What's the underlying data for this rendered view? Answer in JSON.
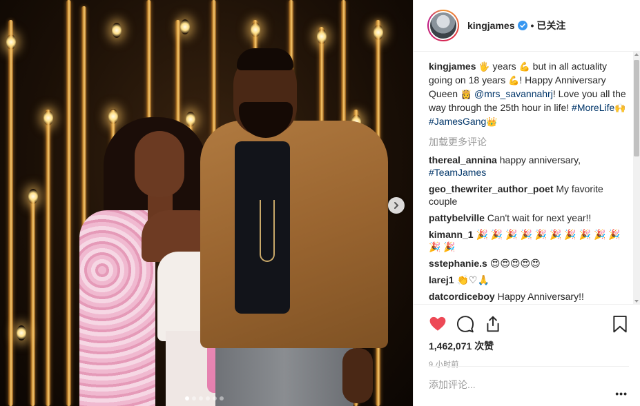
{
  "header": {
    "username": "kingjames",
    "follow_dot": "•",
    "follow_label": "已关注"
  },
  "caption": {
    "username": "kingjames",
    "segments": [
      {
        "t": " "
      },
      {
        "t": "🖐",
        "emoji": true
      },
      {
        "t": " years "
      },
      {
        "t": "💪",
        "emoji": true
      },
      {
        "t": " but in all actuality going on 18 years "
      },
      {
        "t": "💪",
        "emoji": true
      },
      {
        "t": "! Happy Anniversary Queen "
      },
      {
        "t": "👸",
        "emoji": true
      },
      {
        "t": " "
      },
      {
        "t": "@mrs_savannahrj",
        "tag": true
      },
      {
        "t": "! Love you all the way through the 25th hour in life! "
      },
      {
        "t": "#MoreLife",
        "tag": true
      },
      {
        "t": "🙌",
        "emoji": true
      },
      {
        "t": " "
      },
      {
        "t": "#JamesGang",
        "tag": true
      },
      {
        "t": "👑",
        "emoji": true
      }
    ]
  },
  "load_more": "加载更多评论",
  "comments": [
    {
      "user": "thereal_annina",
      "text": " happy anniversary, ",
      "tag": "#TeamJames"
    },
    {
      "user": "geo_thewriter_author_poet",
      "text": " My favorite couple",
      "tag": ""
    },
    {
      "user": "pattybelville",
      "text": " Can't wait for next year!!",
      "tag": ""
    },
    {
      "user": "kimann_1",
      "text": " 🎉 🎉 🎉 🎉 🎉 🎉 🎉 🎉 🎉 🎉 🎉 🎉",
      "tag": ""
    },
    {
      "user": "sstephanie.s",
      "text": " 😍😍😍😍😍",
      "tag": ""
    },
    {
      "user": "larej1",
      "text": " 👏♡🙏",
      "tag": ""
    },
    {
      "user": "datcordiceboy",
      "text": " Happy Anniversary!!",
      "tag": ""
    }
  ],
  "icons": {
    "like": "heart-icon",
    "comment": "comment-bubble-icon",
    "share": "share-icon",
    "save": "bookmark-icon",
    "next": "chevron-right-icon",
    "verified": "verified-badge-icon"
  },
  "likes": {
    "count": "1,462,071",
    "label": "次赞"
  },
  "time_ago": "9 小时前",
  "add_comment": {
    "placeholder": "添加评论..."
  },
  "more_label": "•••",
  "colors": {
    "like": "#ed4956",
    "link": "#003569",
    "verified": "#3897f0",
    "muted": "#999999"
  },
  "carousel": {
    "slides": 6,
    "active_index": 0
  }
}
